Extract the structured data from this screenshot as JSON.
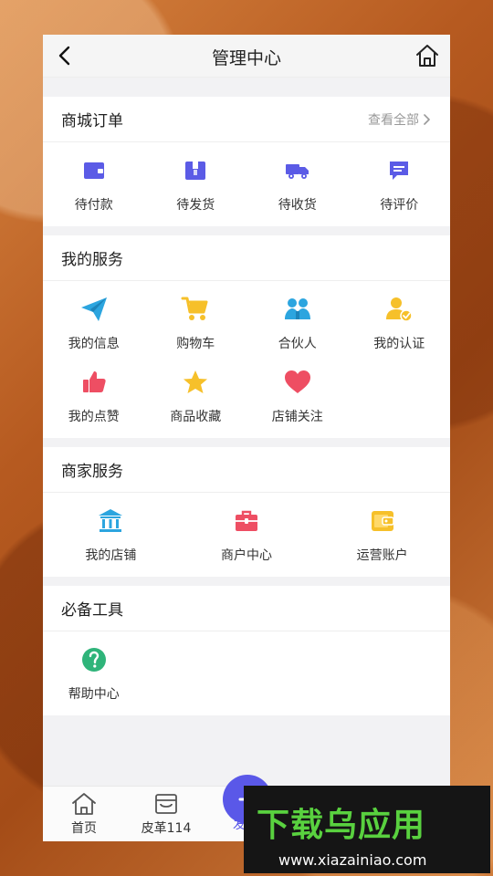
{
  "header": {
    "title": "管理中心"
  },
  "orders": {
    "title": "商城订单",
    "view_all": "查看全部",
    "items": [
      {
        "label": "待付款",
        "icon": "wallet-icon"
      },
      {
        "label": "待发货",
        "icon": "package-icon"
      },
      {
        "label": "待收货",
        "icon": "truck-icon"
      },
      {
        "label": "待评价",
        "icon": "comment-icon"
      }
    ]
  },
  "services": {
    "title": "我的服务",
    "items": [
      {
        "label": "我的信息",
        "icon": "paper-plane-icon"
      },
      {
        "label": "购物车",
        "icon": "cart-icon"
      },
      {
        "label": "合伙人",
        "icon": "partner-icon"
      },
      {
        "label": "我的认证",
        "icon": "verified-user-icon"
      },
      {
        "label": "我的点赞",
        "icon": "thumbs-up-icon"
      },
      {
        "label": "商品收藏",
        "icon": "star-icon"
      },
      {
        "label": "店铺关注",
        "icon": "heart-icon"
      }
    ]
  },
  "merchant": {
    "title": "商家服务",
    "items": [
      {
        "label": "我的店铺",
        "icon": "store-icon"
      },
      {
        "label": "商户中心",
        "icon": "briefcase-icon"
      },
      {
        "label": "运营账户",
        "icon": "account-wallet-icon"
      }
    ]
  },
  "tools": {
    "title": "必备工具",
    "items": [
      {
        "label": "帮助中心",
        "icon": "help-icon"
      }
    ]
  },
  "bottom_nav": {
    "items": [
      {
        "label": "首页",
        "icon": "home-icon"
      },
      {
        "label": "皮革114",
        "icon": "market-icon"
      }
    ],
    "center_label": "发"
  },
  "watermark": {
    "main": "下载乌应用",
    "sub": "www.xiazainiao.com"
  },
  "colors": {
    "purple": "#5b5be6",
    "blue": "#2ca5df",
    "yellow": "#f6c02a",
    "red": "#ee4e63",
    "green": "#2fb47a",
    "watermark_green": "#59d13f"
  }
}
